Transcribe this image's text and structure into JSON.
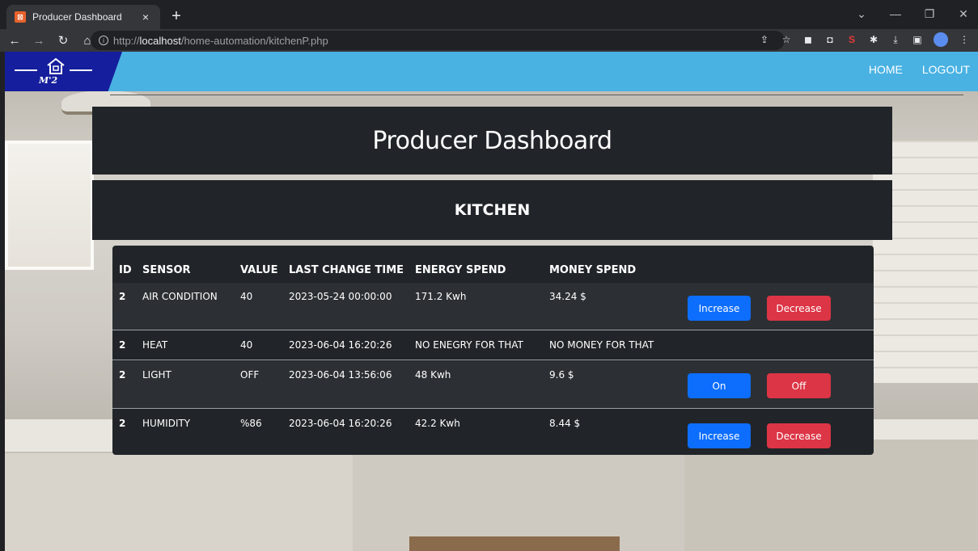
{
  "browser": {
    "tab_title": "Producer Dashboard",
    "tab_close": "×",
    "new_tab": "+",
    "url_prefix": "http://",
    "url_host": "localhost",
    "url_path": "/home-automation/kitchenP.php"
  },
  "navbar": {
    "logo_text": "M'2",
    "home": "HOME",
    "logout": "LOGOUT",
    "bg_color": "#49b2e3",
    "logo_color": "#151e9c"
  },
  "page": {
    "title": "Producer Dashboard",
    "room": "KITCHEN"
  },
  "table": {
    "headers": {
      "id": "ID",
      "sensor": "SENSOR",
      "value": "VALUE",
      "time": "LAST CHANGE TIME",
      "energy": "ENERGY SPEND",
      "money": "MONEY SPEND"
    },
    "rows": [
      {
        "id": "2",
        "sensor": "AIR CONDITION",
        "value": "40",
        "time": "2023-05-24 00:00:00",
        "energy": "171.2 Kwh",
        "money": "34.24 $",
        "btn1": "Increase",
        "btn2": "Decrease"
      },
      {
        "id": "2",
        "sensor": "HEAT",
        "value": "40",
        "time": "2023-06-04 16:20:26",
        "energy": "NO ENEGRY FOR THAT",
        "money": "NO MONEY FOR THAT"
      },
      {
        "id": "2",
        "sensor": "LIGHT",
        "value": "OFF",
        "time": "2023-06-04 13:56:06",
        "energy": "48 Kwh",
        "money": "9.6 $",
        "btn1": "On",
        "btn2": "Off"
      },
      {
        "id": "2",
        "sensor": "HUMIDITY",
        "value": "%86",
        "time": "2023-06-04 16:20:26",
        "energy": "42.2 Kwh",
        "money": "8.44 $",
        "btn1": "Increase",
        "btn2": "Decrease"
      }
    ]
  },
  "colors": {
    "primary": "#0d6efd",
    "danger": "#dc3545",
    "dark": "#212529"
  }
}
